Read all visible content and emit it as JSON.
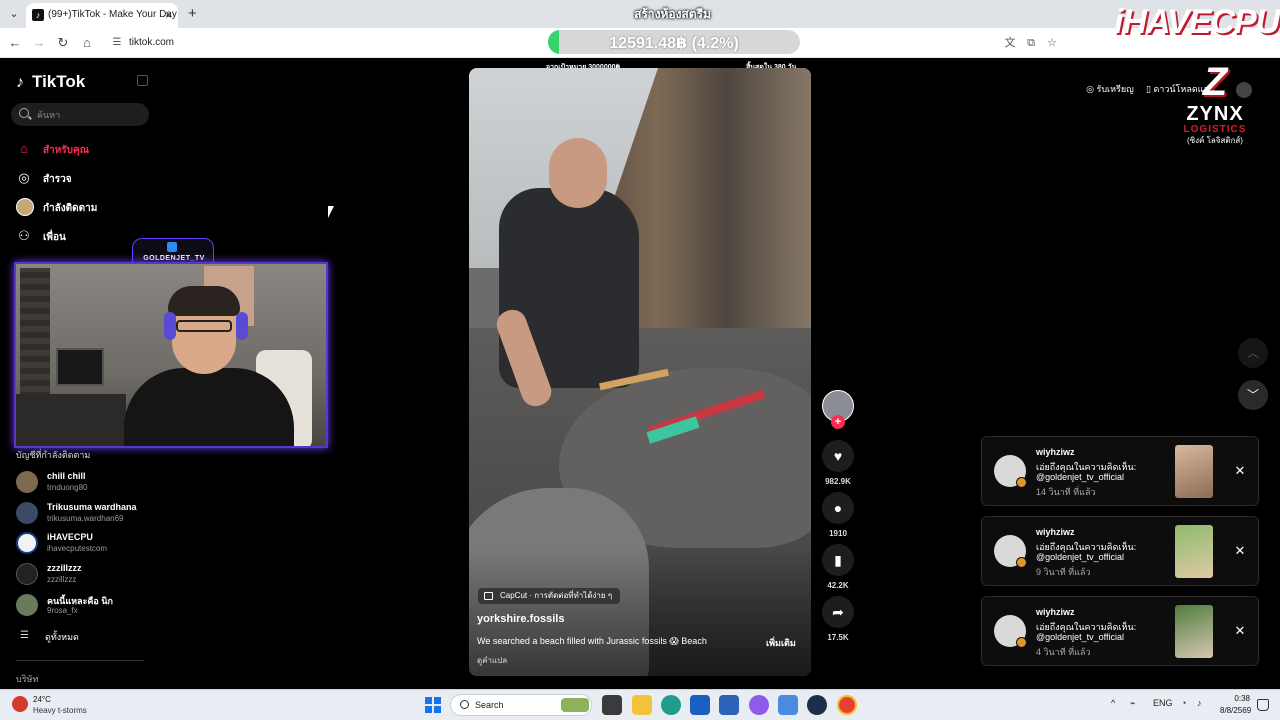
{
  "browser": {
    "tab_title": "(99+)TikTok - Make Your Day",
    "tab_favicon": "tiktok-logo",
    "url": "tiktok.com",
    "icons": [
      "tab-search-icon",
      "back-icon",
      "forward-icon",
      "reload-icon",
      "home-icon",
      "site-info-icon",
      "translate-icon",
      "cast-icon",
      "bookmark-star-icon"
    ]
  },
  "stream_overlay": {
    "title": "สร้างห้องสตรีม",
    "donation_amount": "12591.48฿ (4.2%)",
    "donation_progress_percent": 4.2,
    "goal_left": "จากเป้าหมาย 3000000฿",
    "goal_right": "สิ้นสุดใน 380 วัน",
    "brand": "iHAVECPU",
    "sponsor_name": "ZYNX",
    "sponsor_sub": "LOGISTICS",
    "sponsor_thai": "(ซิงค์ โลจิสติกส์)",
    "webcam_badge": "GOLDENJET_TV",
    "accent_color": "#39d36c",
    "frame_color": "#5a36c8"
  },
  "sidebar": {
    "logo": "TikTok",
    "search_placeholder": "ค้นหา",
    "nav": [
      {
        "label": "สำหรับคุณ",
        "icon": "home-icon",
        "active": true
      },
      {
        "label": "สำรวจ",
        "icon": "compass-icon",
        "active": false
      },
      {
        "label": "กำลังติดตาม",
        "icon": "following-avatar-icon",
        "active": false
      },
      {
        "label": "เพื่อน",
        "icon": "friends-icon",
        "active": false
      }
    ],
    "following_heading": "บัญชีที่กำลังติดตาม",
    "following": [
      {
        "name": "chill chill",
        "handle": "trnduong80"
      },
      {
        "name": "Trikusuma wardhana",
        "handle": "trikusuma.wardhan69"
      },
      {
        "name": "iHAVECPU",
        "handle": "ihavecputestcom"
      },
      {
        "name": "zzzillzzz",
        "handle": "zzzillzzz"
      },
      {
        "name": "คนนี้แหละคือ นิก",
        "handle": "9rosa_fx"
      }
    ],
    "see_all": "ดูทั้งหมด",
    "company": "บริษัท"
  },
  "video": {
    "capcut_label": "CapCut · การตัดต่อที่ทำได้ง่าย ๆ",
    "author": "yorkshire.fossils",
    "description": "We searched a beach filled with Jurassic fossils 😱 Beach",
    "more": "เพิ่มเติม",
    "translate": "ดูคำแปล",
    "actions": [
      {
        "icon": "heart-icon",
        "count": "982.9K"
      },
      {
        "icon": "comment-icon",
        "count": "1910"
      },
      {
        "icon": "bookmark-icon",
        "count": "42.2K"
      },
      {
        "icon": "share-icon",
        "count": "17.5K"
      }
    ],
    "accent_color": "#fe2c55"
  },
  "header_right": {
    "get_coins": "รับเหรียญ",
    "download_app": "ดาวน์โหลดแอป"
  },
  "notifications": [
    {
      "user": "wiyhziwz",
      "text": "เอ่ยถึงคุณในความคิดเห็น:",
      "mention": "@goldenjet_tv_official",
      "time": "14 วินาที ที่แล้ว"
    },
    {
      "user": "wiyhziwz",
      "text": "เอ่ยถึงคุณในความคิดเห็น:",
      "mention": "@goldenjet_tv_official",
      "time": "9 วินาที ที่แล้ว"
    },
    {
      "user": "wiyhziwz",
      "text": "เอ่ยถึงคุณในความคิดเห็น:",
      "mention": "@goldenjet_tv_official",
      "time": "4 วินาที ที่แล้ว"
    }
  ],
  "taskbar": {
    "temp": "24°C",
    "weather": "Heavy t-storms",
    "search_label": "Search",
    "language": "ENG",
    "time": "0:38",
    "date": "8/8/2569"
  }
}
